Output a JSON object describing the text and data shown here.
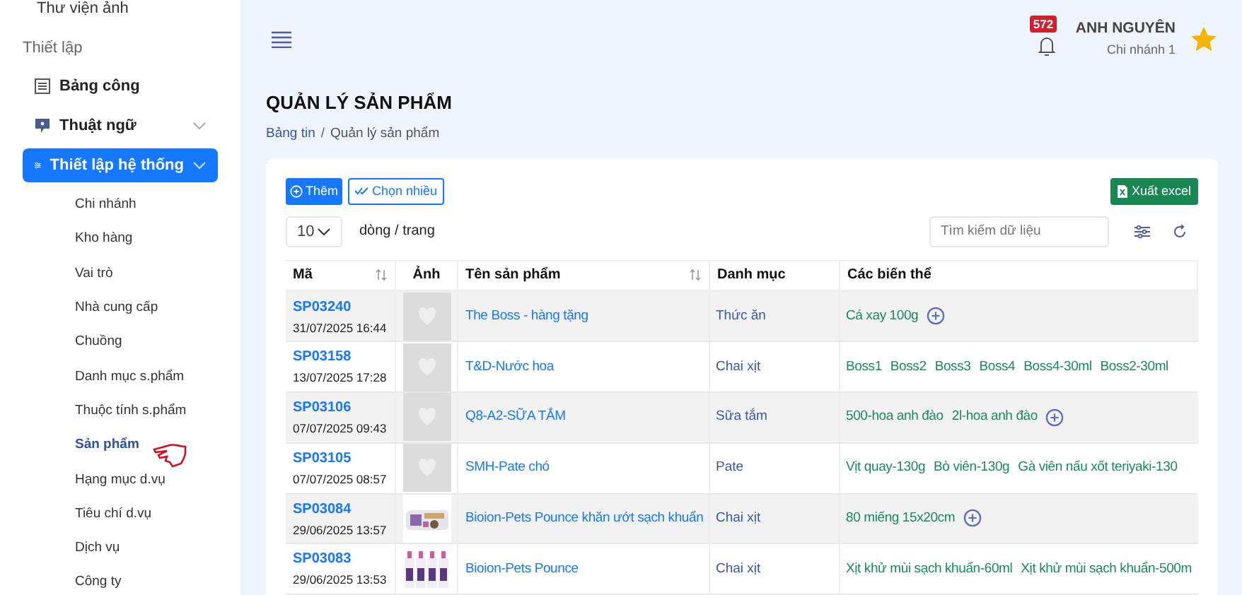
{
  "sidebar": {
    "cut_item": "Thư viện ảnh",
    "section": "Thiết lập",
    "items": [
      {
        "label": "Bảng công",
        "selected": false,
        "expandable": false
      },
      {
        "label": "Thuật ngữ",
        "selected": false,
        "expandable": true
      },
      {
        "label": "Thiết lập hệ thống",
        "selected": true,
        "expandable": true,
        "children": [
          {
            "label": "Chi nhánh",
            "selected": false
          },
          {
            "label": "Kho hàng",
            "selected": false
          },
          {
            "label": "Vai trò",
            "selected": false
          },
          {
            "label": "Nhà cung cấp",
            "selected": false
          },
          {
            "label": "Chuồng",
            "selected": false
          },
          {
            "label": "Danh mục s.phẩm",
            "selected": false
          },
          {
            "label": "Thuộc tính s.phẩm",
            "selected": false
          },
          {
            "label": "Sản phẩm",
            "selected": true
          },
          {
            "label": "Hạng mục d.vụ",
            "selected": false
          },
          {
            "label": "Tiêu chí d.vụ",
            "selected": false
          },
          {
            "label": "Dịch vụ",
            "selected": false
          },
          {
            "label": "Công ty",
            "selected": false
          }
        ]
      }
    ]
  },
  "header": {
    "notifications": "572",
    "user_name": "ANH NGUYÊN",
    "branch": "Chi nhánh 1"
  },
  "page": {
    "title": "QUẢN LÝ SẢN PHẨM",
    "breadcrumb": [
      "Bảng tin",
      "Quản lý sản phẩm"
    ],
    "breadcrumb_separator": "/"
  },
  "toolbar": {
    "add": "Thêm",
    "multi_select": "Chọn nhiều",
    "export": "Xuất excel",
    "page_size": "10",
    "page_size_label": "dòng / trang",
    "search_placeholder": "Tìm kiếm dữ liệu"
  },
  "table": {
    "columns": [
      {
        "label": "Mã",
        "sortable": true
      },
      {
        "label": "Ảnh",
        "sortable": false
      },
      {
        "label": "Tên sản phẩm",
        "sortable": true
      },
      {
        "label": "Danh mục",
        "sortable": false
      },
      {
        "label": "Các biến thể",
        "sortable": false
      }
    ],
    "rows": [
      {
        "code": "SP03240",
        "date": "31/07/2025 16:44",
        "kind": "placeholder",
        "name": "The Boss - hàng tặng",
        "category": "Thức ăn",
        "variants": [
          "Cá xay 100g"
        ],
        "add": true
      },
      {
        "code": "SP03158",
        "date": "13/07/2025 17:28",
        "kind": "placeholder",
        "name": "T&D-Nước hoa",
        "category": "Chai xịt",
        "variants": [
          "Boss1",
          "Boss2",
          "Boss3",
          "Boss4",
          "Boss4-30ml",
          "Boss2-30ml"
        ],
        "add": false
      },
      {
        "code": "SP03106",
        "date": "07/07/2025 09:43",
        "kind": "placeholder",
        "name": "Q8-A2-SỮA TẮM",
        "category": "Sữa tắm",
        "variants": [
          "500-hoa anh đào",
          "2l-hoa anh đào"
        ],
        "add": true
      },
      {
        "code": "SP03105",
        "date": "07/07/2025 08:57",
        "kind": "placeholder",
        "name": "SMH-Pate chó",
        "category": "Pate",
        "variants": [
          "Vịt quay-130g",
          "Bò viên-130g",
          "Gà viên nấu xốt teriyaki-130"
        ],
        "add": false
      },
      {
        "code": "SP03084",
        "date": "29/06/2025 13:57",
        "kind": "picture",
        "name": "Bioion-Pets Pounce khăn ướt sạch khuẩn",
        "category": "Chai xịt",
        "variants": [
          "80 miếng 15x20cm"
        ],
        "add": true
      },
      {
        "code": "SP03083",
        "date": "29/06/2025 13:53",
        "kind": "picture",
        "name": "Bioion-Pets Pounce",
        "category": "Chai xịt",
        "variants": [
          "Xịt khử mùi sạch khuẩn-60ml",
          "Xịt khử mùi sạch khuẩn-500m"
        ],
        "add": false
      }
    ]
  }
}
